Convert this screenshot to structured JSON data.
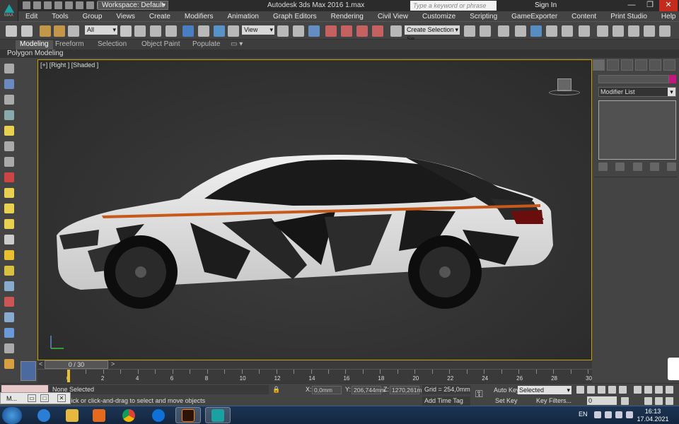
{
  "titlebar": {
    "workspace": "Workspace: Default",
    "title": "Autodesk 3ds Max 2016     1.max",
    "search_placeholder": "Type a keyword or phrase",
    "signin": "Sign In",
    "logo_text": "MAX"
  },
  "menu": [
    "Edit",
    "Tools",
    "Group",
    "Views",
    "Create",
    "Modifiers",
    "Animation",
    "Graph Editors",
    "Rendering",
    "Civil View",
    "Customize",
    "Scripting",
    "GameExporter",
    "Content",
    "Print Studio",
    "Help"
  ],
  "toolbar": {
    "filter": "All",
    "ref_coord": "View",
    "selection_set": "Create Selection Se"
  },
  "ribbon": {
    "tabs": [
      "Modeling",
      "Freeform",
      "Selection",
      "Object Paint",
      "Populate"
    ],
    "active": "Modeling",
    "sub": "Polygon Modeling"
  },
  "viewport": {
    "label": "[+] [Right ] [Shaded ]"
  },
  "command_panel": {
    "modifier_list": "Modifier List",
    "object_color": "#c2187e"
  },
  "timeline": {
    "slider": "0 / 30",
    "ticks": [
      "0",
      "2",
      "4",
      "6",
      "8",
      "10",
      "12",
      "14",
      "16",
      "18",
      "20",
      "22",
      "24",
      "26",
      "28",
      "30"
    ]
  },
  "status": {
    "selection": "None Selected",
    "prompt": "Click or click-and-drag to select and move objects",
    "x_label": "X:",
    "x": "0,0mm",
    "y_label": "Y:",
    "y": "206,744mm",
    "z_label": "Z:",
    "z": "1270,261m",
    "grid": "Grid = 254,0mm",
    "add_time_tag": "Add Time Tag",
    "auto_key": "Auto Key",
    "set_key": "Set Key",
    "key_mode": "Selected",
    "key_filters": "Key Filters...",
    "frame": "0"
  },
  "min_window": {
    "label": "M..."
  },
  "taskbar": {
    "lang": "EN",
    "time": "16:13",
    "date": "17.04.2021",
    "apps": [
      "internet-explorer",
      "file-explorer",
      "media-player",
      "chrome",
      "teamviewer",
      "illustrator",
      "3ds-max"
    ]
  },
  "colors": {
    "viewport_border": "#c8a000",
    "accent": "#1ba1a1"
  }
}
